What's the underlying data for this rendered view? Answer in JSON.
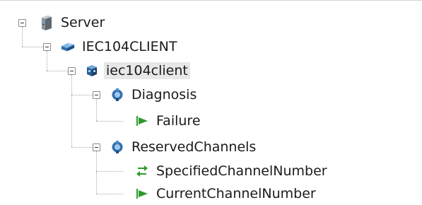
{
  "tree": {
    "root": {
      "label": "Server",
      "icon": "server-icon"
    },
    "client_device": {
      "label": "IEC104CLIENT",
      "icon": "network-device-icon"
    },
    "client_instance": {
      "label": "iec104client",
      "icon": "module-icon",
      "selected": true
    },
    "diagnosis": {
      "label": "Diagnosis",
      "icon": "folder-object-icon"
    },
    "failure": {
      "label": "Failure",
      "icon": "arrow-right-icon"
    },
    "reserved_channels": {
      "label": "ReservedChannels",
      "icon": "folder-object-icon"
    },
    "specified_channel_number": {
      "label": "SpecifiedChannelNumber",
      "icon": "bidirectional-arrows-icon"
    },
    "current_channel_number": {
      "label": "CurrentChannelNumber",
      "icon": "arrow-right-icon"
    }
  },
  "colors": {
    "connector": "#a8a8a8",
    "selection": "#e8e8e8",
    "arrow_green": "#2e9a2e",
    "object_blue": "#2f6fb0"
  }
}
